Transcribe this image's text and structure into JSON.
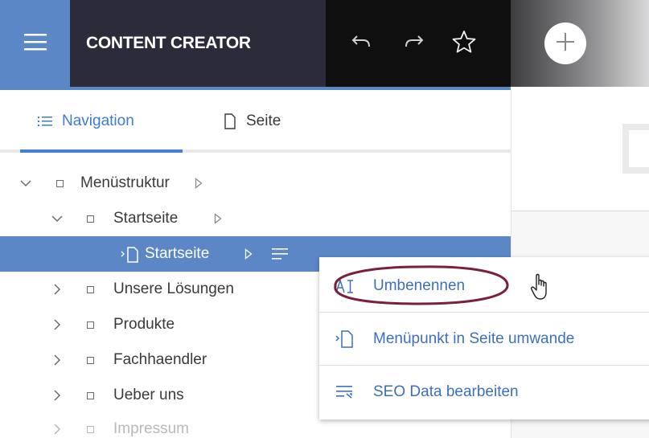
{
  "header": {
    "app_title": "CONTENT CREATOR",
    "menu_icon": "hamburger-icon",
    "toolbar": [
      {
        "icon": "undo-icon"
      },
      {
        "icon": "redo-icon"
      },
      {
        "icon": "star-icon"
      }
    ],
    "add_icon": "plus-icon"
  },
  "tabs": [
    {
      "label": "Navigation",
      "icon": "list-icon",
      "active": true
    },
    {
      "label": "Seite",
      "icon": "page-icon",
      "active": false
    }
  ],
  "tree": {
    "items": [
      {
        "label": "Menüstruktur",
        "level": 0,
        "expanded": true
      },
      {
        "label": "Startseite",
        "level": 1,
        "expanded": true
      },
      {
        "label": "Startseite",
        "level": 2,
        "selected": true,
        "type": "page"
      },
      {
        "label": "Unsere Lösungen",
        "level": 1,
        "expanded": false
      },
      {
        "label": "Produkte",
        "level": 1,
        "expanded": false
      },
      {
        "label": "Fachhaendler",
        "level": 1,
        "expanded": false
      },
      {
        "label": "Ueber uns",
        "level": 1,
        "expanded": false
      },
      {
        "label": "Impressum",
        "level": 1,
        "expanded": false
      }
    ]
  },
  "context_menu": {
    "items": [
      {
        "label": "Umbenennen",
        "icon": "rename-icon"
      },
      {
        "label": "Menüpunkt in Seite umwande",
        "icon": "convert-to-page-icon"
      },
      {
        "label": "SEO Data bearbeiten",
        "icon": "seo-icon"
      }
    ]
  },
  "colors": {
    "accent": "#5b87c6",
    "title_bar": "#2c2b3a",
    "toolbar": "#0f0f10",
    "link": "#3d6fbf",
    "annotation": "#7a1f3d"
  }
}
